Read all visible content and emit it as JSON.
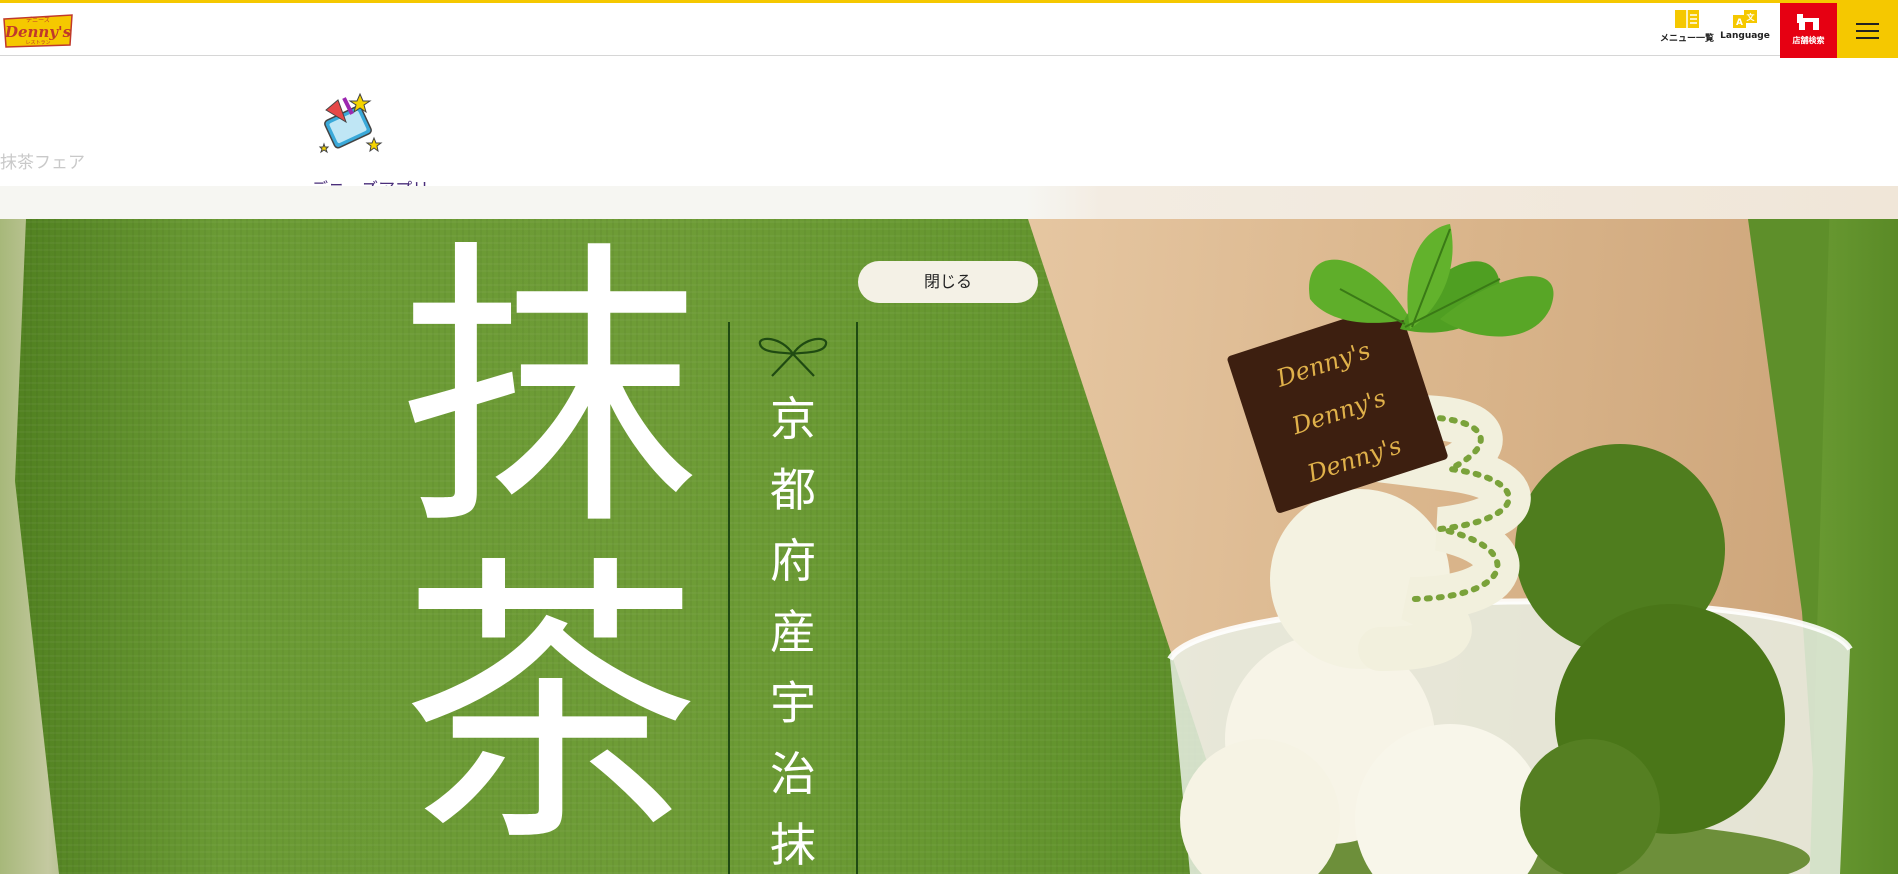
{
  "header": {
    "logo_text": "Denny's",
    "logo_subtext_top": "デニーズ",
    "logo_subtext_bottom": "レストラン",
    "menu_label": "メニュー一覧",
    "language_label": "Language",
    "store_search_label": "店舗検索",
    "accent_color": "#f5c800",
    "store_color": "#e60012"
  },
  "page": {
    "title": "抹茶フェア",
    "app_link": "デニーズアプリ"
  },
  "hero": {
    "big_text_1": "抹",
    "big_text_2": "茶",
    "vertical_text": "京都府産宇治抹",
    "close_button": "閉じる",
    "chocolate_text": "Denny's"
  }
}
